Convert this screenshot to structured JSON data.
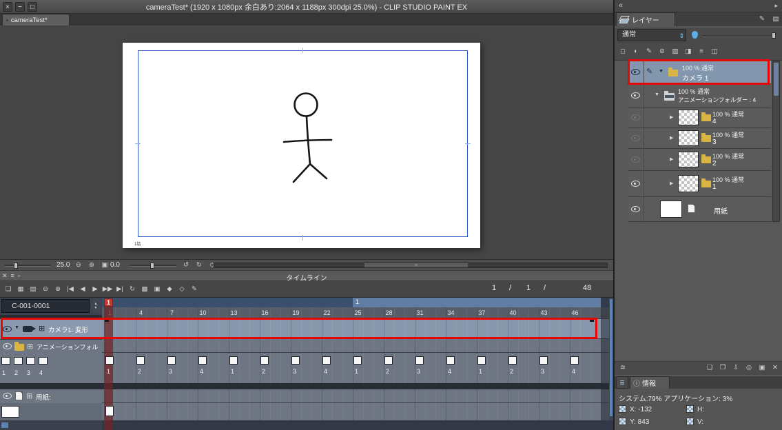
{
  "annotation_color": "#e60800",
  "glyphs": {
    "win_close": "×",
    "win_min": "−",
    "win_max": "□",
    "panel_close": "✕",
    "panel_menu": "≡",
    "panel_float": "▫",
    "spin_up": "▴",
    "spin_down": "▾",
    "tri_down": "▼",
    "tri_right": "▶",
    "plus_box": "⊞",
    "pen": "✎",
    "collapse": "«",
    "menu_arrow": "▸",
    "grip": "≡",
    "slider_arrows": "⇕",
    "tab_dot": "▪",
    "info_icon": "ⓘ",
    "small_tab": "≣"
  },
  "window": {
    "title": "cameraTest* (1920 x 1080px 余白あり:2064 x 1188px 300dpi 25.0%)  - CLIP STUDIO PAINT EX"
  },
  "document_tab": {
    "label": "cameraTest*"
  },
  "canvas": {
    "page_label": "1話",
    "zoom_value": "25.0",
    "rotation_value": "0.0",
    "zoom_icons": [
      {
        "name": "zoom-out-icon",
        "glyph": "⊖"
      },
      {
        "name": "zoom-in-icon",
        "glyph": "⊕"
      },
      {
        "name": "fit-screen-icon",
        "glyph": "▣"
      }
    ],
    "rotate_icons": [
      {
        "name": "rotate-left-icon",
        "glyph": "↺"
      },
      {
        "name": "rotate-right-icon",
        "glyph": "↻"
      },
      {
        "name": "reset-view-icon",
        "glyph": "◇"
      }
    ]
  },
  "timeline": {
    "panel_title": "タイムライン",
    "cut_label": "C-001-0001",
    "second_marker": "1",
    "playhead_label": "1",
    "position": {
      "current": "1",
      "sep1": "/",
      "start": "1",
      "sep2": "/",
      "end": "48"
    },
    "frame_labels": [
      1,
      4,
      7,
      10,
      13,
      16,
      19,
      22,
      25,
      28,
      31,
      34,
      37,
      40,
      43,
      46
    ],
    "toolbar_icons": [
      {
        "name": "timeline-select-icon",
        "glyph": "❏"
      },
      {
        "name": "frame-grid-view-icon",
        "glyph": "▦"
      },
      {
        "name": "track-list-view-icon",
        "glyph": "▤"
      },
      {
        "name": "timeline-zoom-out-icon",
        "glyph": "⊖"
      },
      {
        "name": "timeline-zoom-in-icon",
        "glyph": "⊕"
      },
      {
        "name": "first-frame-icon",
        "glyph": "|◀"
      },
      {
        "name": "prev-frame-icon",
        "glyph": "◀"
      },
      {
        "name": "play-icon",
        "glyph": "▶"
      },
      {
        "name": "next-frame-icon",
        "glyph": "▶▶"
      },
      {
        "name": "last-frame-icon",
        "glyph": "▶|"
      },
      {
        "name": "loop-playback-icon",
        "glyph": "↻"
      },
      {
        "name": "onion-skin-icon",
        "glyph": "▩"
      },
      {
        "name": "cel-display-icon",
        "glyph": "▣"
      },
      {
        "name": "enable-keyframe-icon",
        "glyph": "◆"
      },
      {
        "name": "add-keyframe-icon",
        "glyph": "◇"
      },
      {
        "name": "edit-timeline-icon",
        "glyph": "✎"
      }
    ],
    "tracks": {
      "camera": {
        "label": "カメラ1: 変形"
      },
      "folder": {
        "label": "アニメーションフォル",
        "cel_list": [
          "1",
          "2",
          "3",
          "4"
        ]
      },
      "paper": {
        "label": "用紙:"
      }
    },
    "cels": [
      {
        "frame": 1,
        "label": "1"
      },
      {
        "frame": 4,
        "label": "2"
      },
      {
        "frame": 7,
        "label": "3"
      },
      {
        "frame": 10,
        "label": "4"
      },
      {
        "frame": 13,
        "label": "1"
      },
      {
        "frame": 16,
        "label": "2"
      },
      {
        "frame": 19,
        "label": "3"
      },
      {
        "frame": 22,
        "label": "4"
      },
      {
        "frame": 25,
        "label": "1"
      },
      {
        "frame": 28,
        "label": "2"
      },
      {
        "frame": 31,
        "label": "3"
      },
      {
        "frame": 34,
        "label": "4"
      },
      {
        "frame": 37,
        "label": "1"
      },
      {
        "frame": 40,
        "label": "2"
      },
      {
        "frame": 43,
        "label": "3"
      },
      {
        "frame": 46,
        "label": "4"
      }
    ]
  },
  "layer_panel": {
    "tab_label": "レイヤー",
    "blend_mode": "通常",
    "header_icons": [
      {
        "name": "edit-palette-icon",
        "glyph": "✎"
      },
      {
        "name": "palette-options-icon",
        "glyph": "▤"
      }
    ],
    "tool_icons": [
      {
        "name": "thumbnail-size-icon",
        "glyph": "◻"
      },
      {
        "name": "combine-mode-icon",
        "glyph": "◐"
      },
      {
        "name": "draft-layer-icon",
        "glyph": "✎"
      },
      {
        "name": "lock-layer-icon",
        "glyph": "⊘"
      },
      {
        "name": "lock-transparent-icon",
        "glyph": "▨"
      },
      {
        "name": "mask-enable-icon",
        "glyph": "◨"
      },
      {
        "name": "ruler-show-icon",
        "glyph": "≡"
      },
      {
        "name": "layer-color-icon",
        "glyph": "◫"
      }
    ],
    "bottom_icons_left": [
      {
        "name": "onion-skin-settings-icon",
        "glyph": "≋"
      }
    ],
    "bottom_icons_right": [
      {
        "name": "new-layer-icon",
        "glyph": "❏"
      },
      {
        "name": "new-folder-icon",
        "glyph": "❐"
      },
      {
        "name": "merge-down-icon",
        "glyph": "⇩"
      },
      {
        "name": "clipping-icon",
        "glyph": "◎"
      },
      {
        "name": "layer-mask-icon",
        "glyph": "▣"
      },
      {
        "name": "delete-layer-icon",
        "glyph": "✕"
      }
    ],
    "layers": [
      {
        "blend": "100 % 通常",
        "name": "カメラ 1"
      },
      {
        "blend": "100 % 通常",
        "name": "アニメーションフォルダー : 4"
      },
      {
        "blend": "100 % 通常",
        "name": "4"
      },
      {
        "blend": "100 % 通常",
        "name": "3"
      },
      {
        "blend": "100 % 通常",
        "name": "2"
      },
      {
        "blend": "100 % 通常",
        "name": "1"
      },
      {
        "name": "用紙"
      }
    ]
  },
  "info_panel": {
    "tab_label": "情報",
    "system_text": "システム:79% アプリケーション: 3%",
    "x_text": "X: -132",
    "y_text": "Y: 843",
    "h_text": "H:",
    "v_text": "V:"
  }
}
